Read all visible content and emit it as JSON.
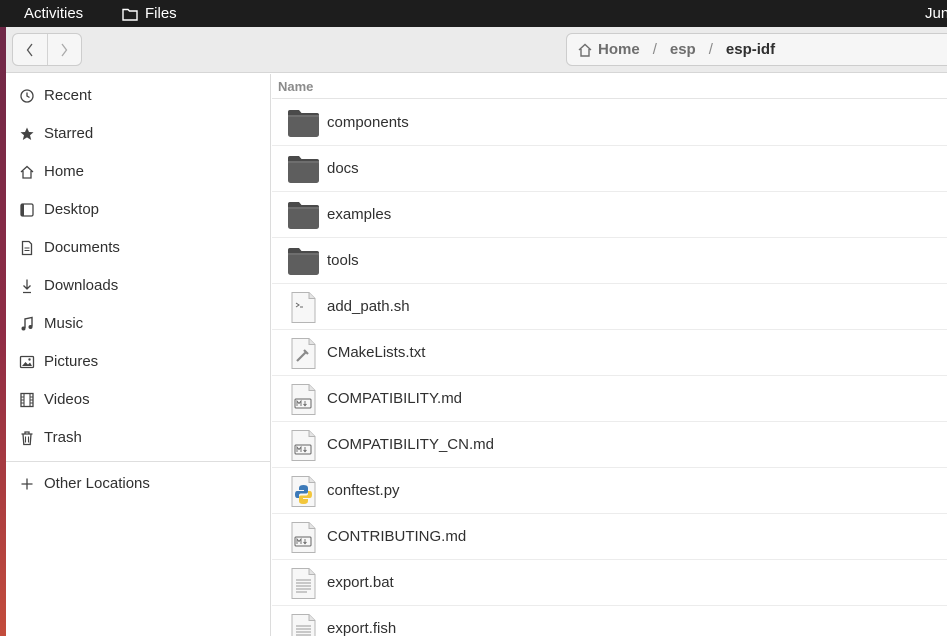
{
  "topbar": {
    "activities": "Activities",
    "app_name": "Files",
    "clock": "Jun"
  },
  "pathbar": {
    "home": "Home",
    "segment": "esp",
    "current": "esp-idf"
  },
  "sidebar": {
    "items": [
      {
        "label": "Recent",
        "icon": "clock-icon"
      },
      {
        "label": "Starred",
        "icon": "star-icon"
      },
      {
        "label": "Home",
        "icon": "home-icon"
      },
      {
        "label": "Desktop",
        "icon": "desktop-icon"
      },
      {
        "label": "Documents",
        "icon": "document-icon"
      },
      {
        "label": "Downloads",
        "icon": "download-icon"
      },
      {
        "label": "Music",
        "icon": "music-icon"
      },
      {
        "label": "Pictures",
        "icon": "picture-icon"
      },
      {
        "label": "Videos",
        "icon": "film-icon"
      },
      {
        "label": "Trash",
        "icon": "trash-icon"
      }
    ],
    "other_locations": "Other Locations"
  },
  "list": {
    "column_name": "Name",
    "files": [
      {
        "name": "components",
        "type": "folder"
      },
      {
        "name": "docs",
        "type": "folder"
      },
      {
        "name": "examples",
        "type": "folder"
      },
      {
        "name": "tools",
        "type": "folder"
      },
      {
        "name": "add_path.sh",
        "type": "script"
      },
      {
        "name": "CMakeLists.txt",
        "type": "cmake"
      },
      {
        "name": "COMPATIBILITY.md",
        "type": "markdown"
      },
      {
        "name": "COMPATIBILITY_CN.md",
        "type": "markdown"
      },
      {
        "name": "conftest.py",
        "type": "python"
      },
      {
        "name": "CONTRIBUTING.md",
        "type": "markdown"
      },
      {
        "name": "export.bat",
        "type": "text"
      },
      {
        "name": "export.fish",
        "type": "text"
      }
    ]
  },
  "colors": {
    "topbar": "#1d1d1d",
    "folder": "#5e5e5e",
    "headerbar": "#ebebeb"
  }
}
